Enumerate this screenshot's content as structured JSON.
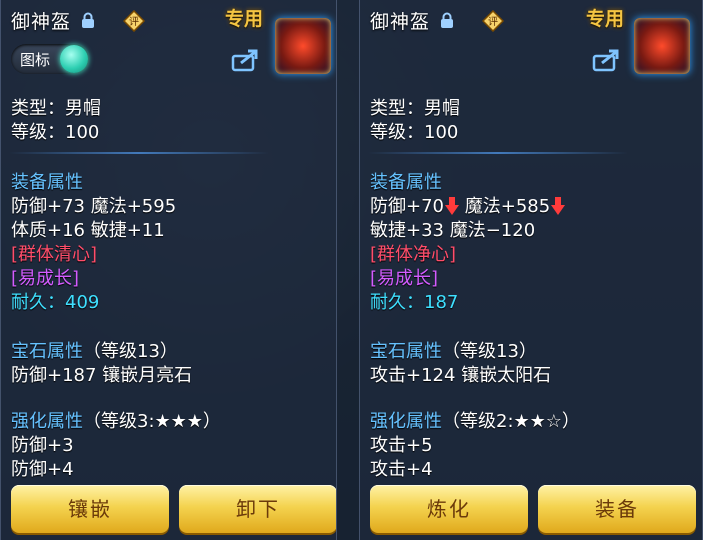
{
  "panels": [
    {
      "title": "御神盔",
      "special_label": "专用",
      "review_badge_text": "评",
      "toggle_label": "图标",
      "type_line": "类型：男帽",
      "level_line": "等级：100",
      "equip_attr_title": "装备属性",
      "attr_line1": "防御+73 魔法+595",
      "attr_line2": "体质+16 敏捷+11",
      "special1": "[群体清心]",
      "special2": "[易成长]",
      "durability": "耐久：409",
      "gem_title": "宝石属性",
      "gem_level": "（等级13）",
      "gem_line": "防御+187 镶嵌月亮石",
      "enhance_title": "强化属性",
      "enhance_level": "（等级3:★★★）",
      "enhance_line1": "防御+3",
      "enhance_line2": "防御+4",
      "button_left": "镶嵌",
      "button_right": "卸下"
    },
    {
      "title": "御神盔",
      "special_label": "专用",
      "review_badge_text": "评",
      "attr_arrow_icons": [
        "down-arrow-icon",
        "down-arrow-icon"
      ],
      "type_line": "类型：男帽",
      "level_line": "等级：100",
      "equip_attr_title": "装备属性",
      "attr_line1_a": "防御+70",
      "attr_line1_b": "魔法+585",
      "attr_line2": "敏捷+33 魔法−120",
      "special1": "[群体净心]",
      "special2": "[易成长]",
      "durability": "耐久：187",
      "gem_title": "宝石属性",
      "gem_level": "（等级13）",
      "gem_line": "攻击+124 镶嵌太阳石",
      "enhance_title": "强化属性",
      "enhance_level": "（等级2:★★☆）",
      "enhance_line1": "攻击+5",
      "enhance_line2": "攻击+4",
      "button_left": "炼化",
      "button_right": "装备"
    }
  ]
}
